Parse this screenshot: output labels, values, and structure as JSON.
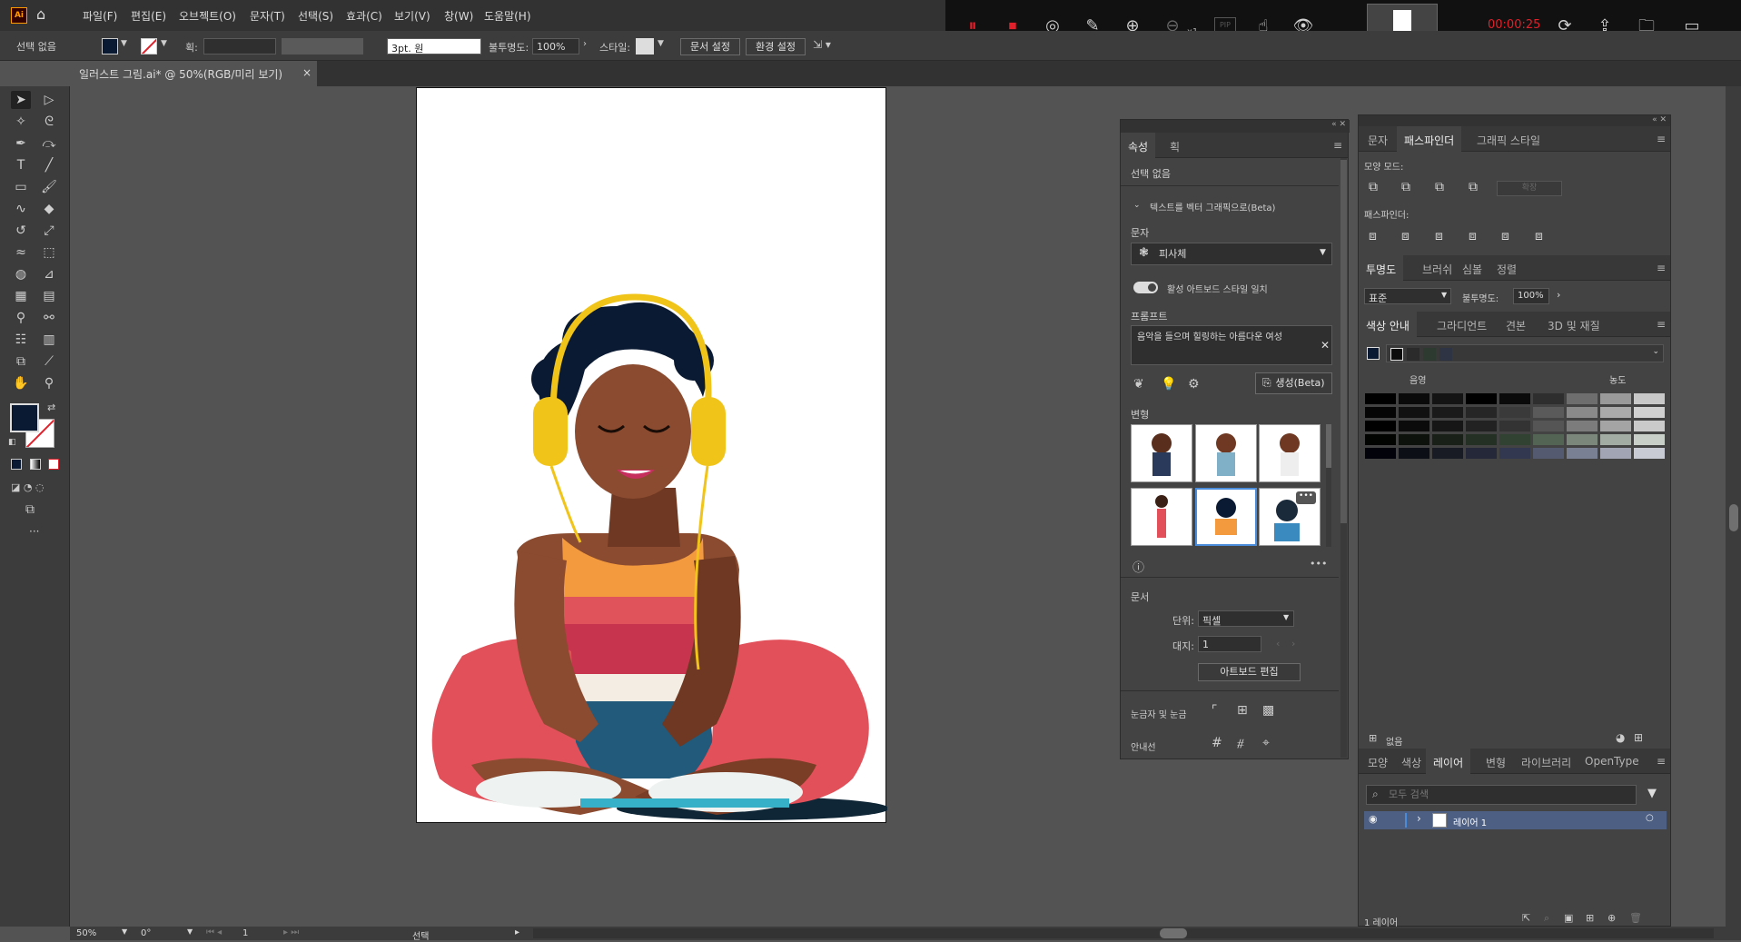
{
  "menu": {
    "app_icon": "Ai",
    "items": [
      "파일(F)",
      "편집(E)",
      "오브젝트(O)",
      "문자(T)",
      "선택(S)",
      "효과(C)",
      "보기(V)",
      "창(W)",
      "도움말(H)"
    ]
  },
  "control": {
    "selection": "선택 없음",
    "stroke_label": "획:",
    "brush": "3pt. 원",
    "opacity_label": "불투명도:",
    "opacity": "100%",
    "style_label": "스타일:",
    "doc_setup": "문서 설정",
    "prefs": "환경 설정"
  },
  "document": {
    "tab_title": "일러스트 그림.ai* @ 50%(RGB/미리 보기)",
    "close": "×"
  },
  "recorder": {
    "time": "00:00:25",
    "zoom": "x1",
    "pip": "PIP"
  },
  "props": {
    "tab1": "속성",
    "tab2": "획",
    "no_selection": "선택 없음",
    "section_title": "텍스트를 벡터 그래픽으로(Beta)",
    "subject_label": "문자",
    "subject_value": "피사체",
    "toggle_label": "활성 아트보드 스타일 일치",
    "prompt_label": "프롬프트",
    "prompt_text": "음악을 들으며 힐링하는 아름다운  여성",
    "generate": "생성(Beta)",
    "variations": "변형",
    "doc_label": "문서",
    "unit_label": "단위:",
    "unit_value": "픽셀",
    "artboard_label": "대지:",
    "artboard_value": "1",
    "edit_artboard": "아트보드 편집",
    "rulers_label": "눈금자 및 눈금",
    "guides_label": "안내선"
  },
  "pathfinder": {
    "tabs": [
      "문자",
      "패스파인더",
      "그래픽 스타일"
    ],
    "shape_modes": "모양 모드:",
    "expand": "확장",
    "pathfinders": "패스파인더:"
  },
  "transparency": {
    "tabs": [
      "투명도",
      "브러쉬",
      "심볼",
      "정렬"
    ],
    "blend": "표준",
    "opacity_label": "불투명도:",
    "opacity": "100%"
  },
  "color_guide": {
    "tabs": [
      "색상 안내",
      "그라디언트",
      "견본",
      "3D 및 재질"
    ],
    "shade": "음영",
    "tint": "농도",
    "none": "없음"
  },
  "layers": {
    "tabs": [
      "모양",
      "색상",
      "레이어",
      "변형",
      "라이브러리",
      "OpenType"
    ],
    "search": "모두 검색",
    "layer_name": "레이어 1",
    "count": "1 레이어"
  },
  "status": {
    "zoom": "50%",
    "rotate": "0°",
    "page": "1",
    "tool": "선택"
  },
  "colors": {
    "accent": "#4a8cd9",
    "fill": "#0b1a33",
    "rec_red": "#e0202a"
  }
}
